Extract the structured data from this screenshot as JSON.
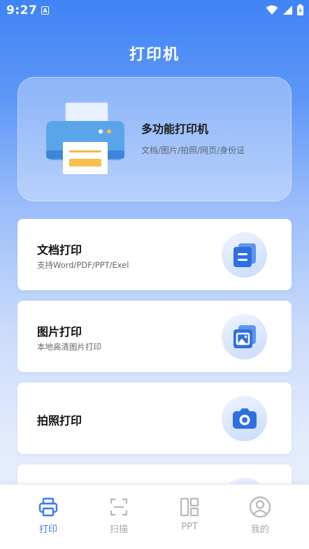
{
  "status_bar": {
    "time": "9:27",
    "notification_glyph": "A"
  },
  "header": {
    "title": "打印机"
  },
  "hero": {
    "title": "多功能打印机",
    "subtitle": "文档/图片/拍照/网页/身份证"
  },
  "cards": [
    {
      "title": "文档打印",
      "subtitle": "支持Word/PDF/PPT/Exel",
      "icon": "document-stack-icon"
    },
    {
      "title": "图片打印",
      "subtitle": "本地高清图片打印",
      "icon": "image-stack-icon"
    },
    {
      "title": "拍照打印",
      "subtitle": "",
      "icon": "camera-icon"
    }
  ],
  "tabs": [
    {
      "label": "打印",
      "active": true,
      "icon": "printer-icon"
    },
    {
      "label": "扫描",
      "active": false,
      "icon": "scan-icon"
    },
    {
      "label": "PPT",
      "active": false,
      "icon": "layout-icon"
    },
    {
      "label": "我的",
      "active": false,
      "icon": "user-icon"
    }
  ],
  "colors": {
    "accent": "#3b7cf4",
    "inactive": "#a7a7a7",
    "icon_blue": "#3f7de8"
  }
}
